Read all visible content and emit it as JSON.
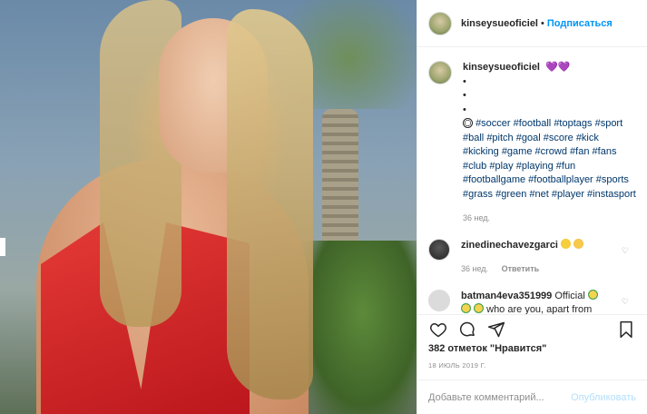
{
  "post": {
    "username": "kinseysueoficiel",
    "separator": "•",
    "follow_label": "Подписаться",
    "caption": {
      "hearts": "💜💜",
      "bullets": [
        "•",
        "•",
        "•"
      ],
      "hashtags": [
        "#soccer",
        "#football",
        "#toptags",
        "#sport",
        "#ball",
        "#pitch",
        "#goal",
        "#score",
        "#kick",
        "#kicking",
        "#game",
        "#crowd",
        "#fan",
        "#fans",
        "#club",
        "#play",
        "#playing",
        "#fun",
        "#footballgame",
        "#footballplayer",
        "#sports",
        "#grass",
        "#green",
        "#net",
        "#player",
        "#instasport"
      ],
      "time": "36 нед."
    },
    "comments": [
      {
        "username": "zinedinechavezgarci",
        "text": "",
        "time": "36 нед.",
        "reply_label": "Ответить"
      },
      {
        "username": "batman4eva351999",
        "text": "Official",
        "text2": "who are you, apart from"
      }
    ],
    "likes_text": "382 отметок \"Нравится\"",
    "date_text": "18 ИЮЛЬ 2019 Г.",
    "comment_placeholder": "Добавьте комментарий...",
    "post_button": "Опубликовать"
  },
  "icons": [
    "heart-icon",
    "comment-icon",
    "share-icon",
    "bookmark-icon"
  ],
  "colors": {
    "link": "#0095f6",
    "hashtag": "#00376b",
    "muted": "#8e8e8e",
    "post_disabled": "#b2dffc"
  }
}
